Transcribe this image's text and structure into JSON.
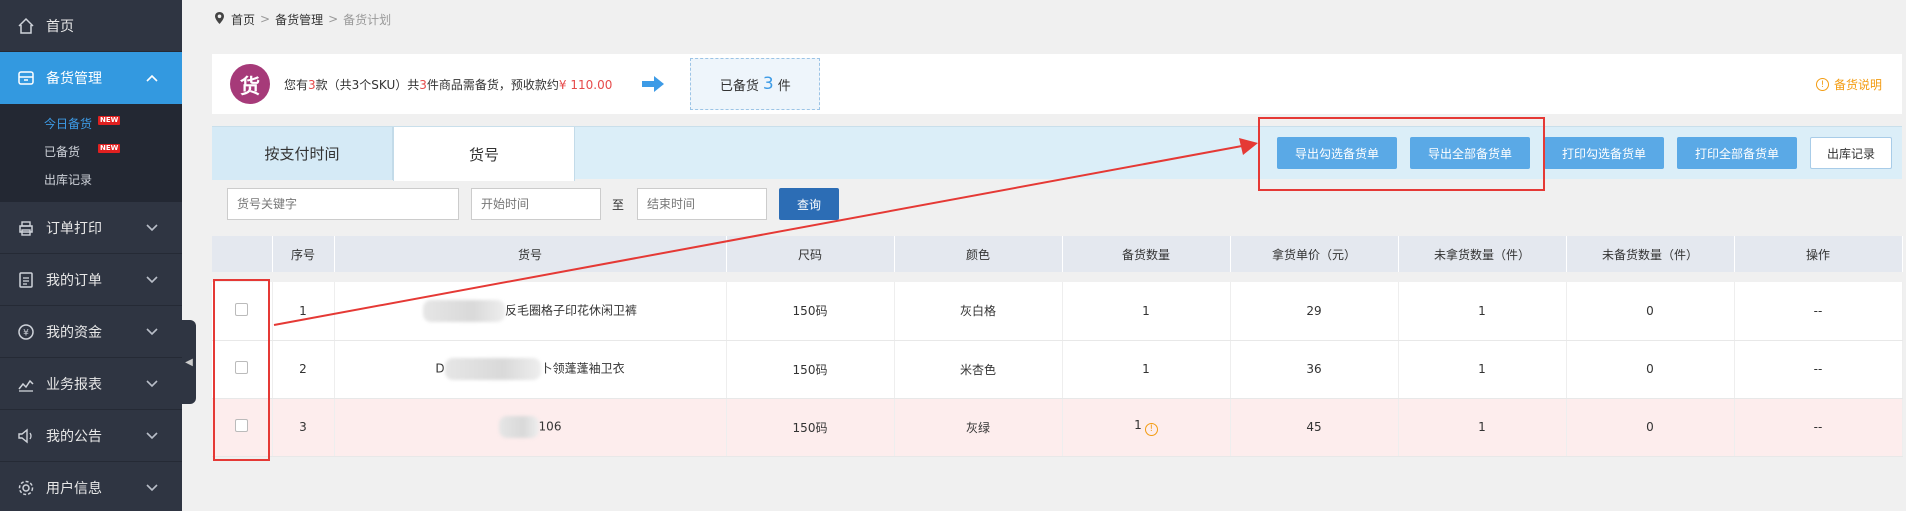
{
  "sidebar": {
    "items": [
      {
        "label": "首页",
        "icon": "home-icon"
      },
      {
        "label": "备货管理",
        "icon": "storage-icon",
        "active": true
      },
      {
        "label": "订单打印",
        "icon": "printer-icon"
      },
      {
        "label": "我的订单",
        "icon": "clipboard-icon"
      },
      {
        "label": "我的资金",
        "icon": "yen-icon"
      },
      {
        "label": "业务报表",
        "icon": "chart-icon"
      },
      {
        "label": "我的公告",
        "icon": "speaker-icon"
      },
      {
        "label": "用户信息",
        "icon": "gear-icon"
      }
    ],
    "sub_items": [
      {
        "label": "今日备货",
        "badge": "NEW",
        "active": true
      },
      {
        "label": "已备货",
        "badge": "NEW"
      },
      {
        "label": "出库记录"
      }
    ]
  },
  "breadcrumb": {
    "home": "首页",
    "section": "备货管理",
    "current": "备货计划"
  },
  "summary": {
    "badge": "货",
    "prefix": "您有",
    "count1": "3",
    "mid1": "款（共3个SKU）共",
    "count2": "3",
    "mid2": "件商品需备货，预收款约",
    "amount": "¥ 110.00",
    "prepared_prefix": "已备货",
    "prepared_count": "3",
    "prepared_suffix": "件",
    "help": "备货说明"
  },
  "tabs": [
    "按支付时间",
    "货号"
  ],
  "actions": [
    "导出勾选备货单",
    "导出全部备货单",
    "打印勾选备货单",
    "打印全部备货单",
    "出库记录"
  ],
  "filters": {
    "keyword_placeholder": "货号关键字",
    "start_placeholder": "开始时间",
    "to": "至",
    "end_placeholder": "结束时间",
    "query": "查询"
  },
  "table": {
    "headers": [
      "",
      "序号",
      "货号",
      "尺码",
      "颜色",
      "备货数量",
      "拿货单价（元）",
      "未拿货数量（件）",
      "未备货数量（件）",
      "操作"
    ],
    "rows": [
      {
        "seq": "1",
        "sku": "反毛圈格子印花休闲卫裤",
        "size": "150码",
        "color": "灰白格",
        "qty": "1",
        "price": "29",
        "unpicked": "1",
        "unprepared": "0",
        "op": "--"
      },
      {
        "seq": "2",
        "sku": "卜领蓬蓬袖卫衣",
        "sku_prefix": "D",
        "size": "150码",
        "color": "米杏色",
        "qty": "1",
        "price": "36",
        "unpicked": "1",
        "unprepared": "0",
        "op": "--"
      },
      {
        "seq": "3",
        "sku": "106",
        "size": "150码",
        "color": "灰绿",
        "qty": "1",
        "price": "45",
        "unpicked": "1",
        "unprepared": "0",
        "op": "--",
        "warning": true
      }
    ]
  },
  "colors": {
    "sidebar": "#2f3542",
    "active": "#3399e0",
    "accent_red": "#e53935",
    "button": "#5aa9e6"
  }
}
